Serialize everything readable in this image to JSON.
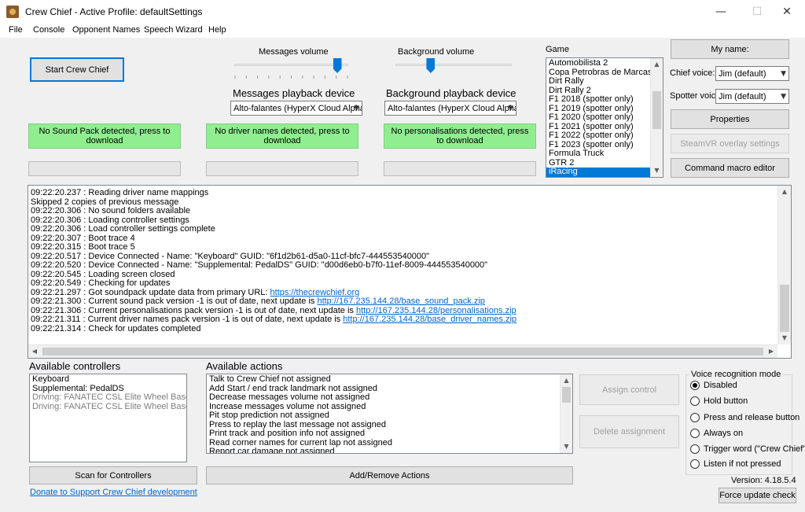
{
  "window": {
    "title": "Crew Chief - Active Profile: defaultSettings",
    "minimize_glyph": "—",
    "maximize_glyph": "☐",
    "close_glyph": "✕"
  },
  "menu": [
    "File",
    "Console",
    "Opponent Names",
    "Speech Wizard",
    "Help"
  ],
  "start_button": "Start Crew Chief",
  "messages_volume": {
    "label": "Messages volume",
    "level": 0.9
  },
  "background_volume": {
    "label": "Background volume",
    "level": 0.3
  },
  "messages_playback": {
    "heading": "Messages playback device",
    "value": "Alto-falantes (HyperX Cloud Alpha S"
  },
  "background_playback": {
    "heading": "Background playback device",
    "value": "Alto-falantes (HyperX Cloud Alpha S"
  },
  "status": {
    "sound_pack": "No Sound Pack detected, press to download",
    "driver_names": "No driver names detected, press to download",
    "personalisations": "No personalisations detected, press to download"
  },
  "game": {
    "label": "Game",
    "items": [
      "Automobilista 2",
      "Copa Petrobras de Marcas",
      "Dirt Rally",
      "Dirt Rally 2",
      "F1 2018 (spotter only)",
      "F1 2019 (spotter only)",
      "F1 2020 (spotter only)",
      "F1 2021 (spotter only)",
      "F1 2022 (spotter only)",
      "F1 2023 (spotter only)",
      "Formula Truck",
      "GTR 2",
      "iRacing"
    ],
    "selected": "iRacing"
  },
  "right_panel": {
    "my_name": "My name:",
    "chief_voice_label": "Chief voice:",
    "chief_voice_value": "Jim (default)",
    "spotter_voice_label": "Spotter voice:",
    "spotter_voice_value": "Jim (default)",
    "properties": "Properties",
    "steamvr": "SteamVR overlay settings",
    "command_macro": "Command macro editor"
  },
  "console_lines": [
    {
      "text": "09:22:20.237 : Reading driver name mappings"
    },
    {
      "text": "Skipped 2 copies of previous message"
    },
    {
      "text": "09:22:20.306 : No sound folders available"
    },
    {
      "text": "09:22:20.306 : Loading controller settings"
    },
    {
      "text": "09:22:20.306 : Load controller settings complete"
    },
    {
      "text": "09:22:20.307 : Boot trace 4"
    },
    {
      "text": "09:22:20.315 : Boot trace 5"
    },
    {
      "text": "09:22:20.517 : Device Connected -  Name: \"Keyboard\"   GUID: \"6f1d2b61-d5a0-11cf-bfc7-444553540000\""
    },
    {
      "text": "09:22:20.520 : Device Connected -  Name: \"Supplemental: PedalDS\"   GUID: \"d00d6eb0-b7f0-11ef-8009-444553540000\""
    },
    {
      "text": "09:22:20.545 : Loading screen closed"
    },
    {
      "text": "09:22:20.549 : Checking for updates"
    },
    {
      "text": "09:22:21.297 : Got soundpack update data from primary URL: ",
      "link": "https://thecrewchief.org"
    },
    {
      "text": "09:22:21.300 : Current sound pack version -1 is out of date, next update is ",
      "link": "http://167.235.144.28/base_sound_pack.zip"
    },
    {
      "text": "09:22:21.306 : Current personalisations pack version -1 is out of date, next update is ",
      "link": "http://167.235.144.28/personalisations.zip"
    },
    {
      "text": "09:22:21.311 : Current driver names pack version -1 is out of date, next update is ",
      "link": "http://167.235.144.28/base_driver_names.zip"
    },
    {
      "text": "09:22:21.314 : Check for updates completed"
    }
  ],
  "controllers": {
    "heading": "Available controllers",
    "items": [
      {
        "text": "Keyboard",
        "grey": false
      },
      {
        "text": "Supplemental: PedalDS",
        "grey": false
      },
      {
        "text": "Driving: FANATEC CSL Elite Wheel Base P",
        "grey": true
      },
      {
        "text": "Driving: FANATEC CSL Elite Wheel Base P",
        "grey": true
      }
    ],
    "scan_button": "Scan for Controllers"
  },
  "actions": {
    "heading": "Available actions",
    "items": [
      "Talk to Crew Chief not assigned",
      "Add Start / end track landmark not assigned",
      "Decrease messages volume not assigned",
      "Increase messages volume not assigned",
      "Pit stop prediction not assigned",
      "Press to replay the last message not assigned",
      "Print track and position info not assigned",
      "Read corner names for current lap not assigned",
      "Report car damage not assigned"
    ],
    "add_remove": "Add/Remove Actions",
    "assign": "Assign control",
    "delete": "Delete assignment"
  },
  "voice_recognition": {
    "title": "Voice recognition mode",
    "options": [
      "Disabled",
      "Hold button",
      "Press and release button",
      "Always on",
      "Trigger word (\"Crew Chief\"",
      "Listen if not pressed"
    ],
    "selected_index": 0
  },
  "donate_link": "Donate to Support Crew Chief development",
  "version": "Version: 4.18.5.4",
  "force_update": "Force update check"
}
